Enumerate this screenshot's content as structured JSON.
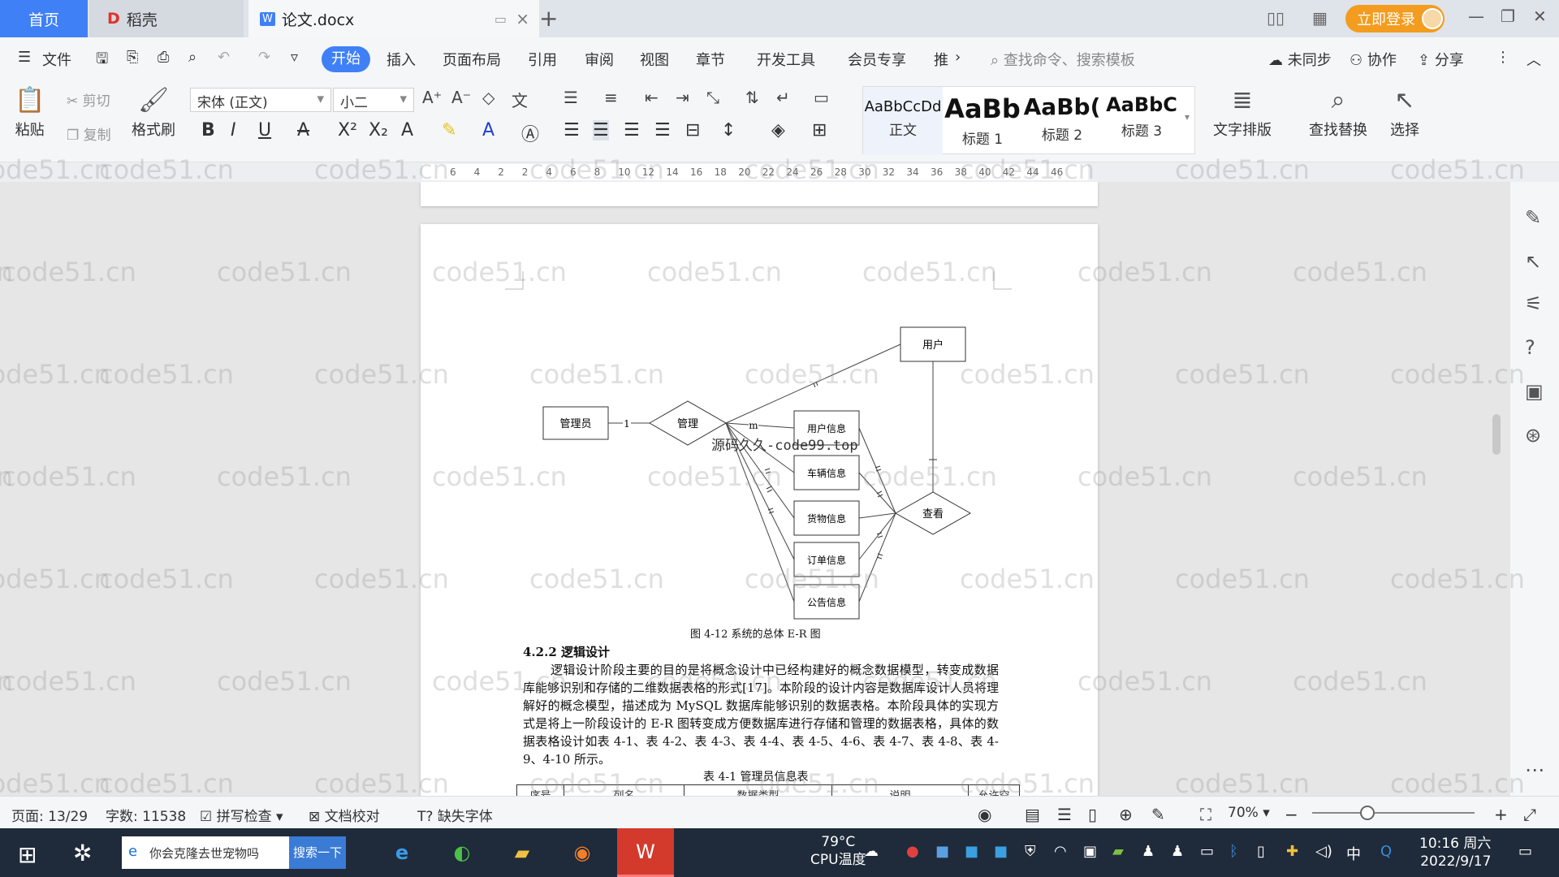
{
  "tabs": {
    "home": "首页",
    "docer": "稻壳",
    "doc": "论文.docx"
  },
  "titlebar": {
    "login": "立即登录"
  },
  "menu": {
    "file": "文件",
    "start": "开始",
    "items": [
      "插入",
      "页面布局",
      "引用",
      "审阅",
      "视图",
      "章节",
      "开发工具",
      "会员专享",
      "推"
    ],
    "search_cmd": "查找命令、搜索模板",
    "sync": "未同步",
    "collab": "协作",
    "share": "分享"
  },
  "ribbon": {
    "paste": "粘贴",
    "cut": "剪切",
    "copy": "复制",
    "format_painter": "格式刷",
    "font_name": "宋体 (正文)",
    "font_size": "小二",
    "styles": [
      {
        "preview": "AaBbCcDd",
        "name": "正文"
      },
      {
        "preview": "AaBb",
        "name": "标题 1"
      },
      {
        "preview": "AaBb(",
        "name": "标题 2"
      },
      {
        "preview": "AaBbC",
        "name": "标题 3"
      }
    ],
    "text_layout": "文字排版",
    "find_replace": "查找替换",
    "select": "选择"
  },
  "ruler": {
    "ticks": [
      "6",
      "4",
      "2",
      "2",
      "4",
      "6",
      "8",
      "10",
      "12",
      "14",
      "16",
      "18",
      "20",
      "22",
      "24",
      "26",
      "28",
      "30",
      "32",
      "34",
      "36",
      "38",
      "40",
      "42",
      "44",
      "46"
    ]
  },
  "er": {
    "admin": "管理员",
    "manage": "管理",
    "user": "用户",
    "view": "查看",
    "one": "1",
    "entities": [
      "用户信息",
      "车辆信息",
      "货物信息",
      "订单信息",
      "公告信息"
    ],
    "m": "m"
  },
  "document": {
    "overlay_text": "源码久久-code99.top",
    "figure_caption": "图 4-12 系统的总体 E-R 图",
    "section_title": "4.2.2 逻辑设计",
    "paragraph": "逻辑设计阶段主要的目的是将概念设计中已经构建好的概念数据模型，转变成数据库能够识别和存储的二维数据表格的形式[17]。本阶段的设计内容是数据库设计人员将理解好的概念模型，描述成为 MySQL 数据库能够识别的数据表格。本阶段具体的实现方式是将上一阶段设计的 E-R 图转变成方便数据库进行存储和管理的数据表格，具体的数据表格设计如表 4-1、表 4-2、表 4-3、表 4-4、表 4-5、4-6、表 4-7、表 4-8、表 4-9、4-10 所示。",
    "table_caption": "表 4-1 管理员信息表",
    "table_headers": [
      "序号",
      "列名",
      "数据类型",
      "说明",
      "允许空"
    ]
  },
  "watermark": "code51.cn",
  "status": {
    "page": "页面: 13/29",
    "words": "字数: 11538",
    "spell": "拼写检查",
    "proof": "文档校对",
    "missing_font": "缺失字体",
    "zoom": "70%"
  },
  "taskbar": {
    "search_text": "你会克隆去世宠物吗",
    "search_btn": "搜索一下",
    "temp": "79°C",
    "temp_label": "CPU温度",
    "ime": "中",
    "time": "10:16 周六",
    "date": "2022/9/17"
  }
}
